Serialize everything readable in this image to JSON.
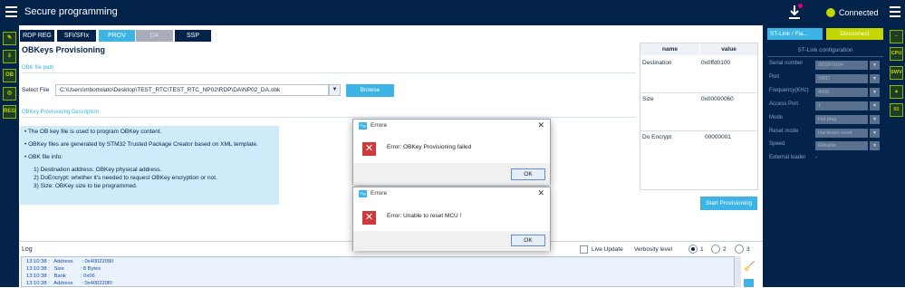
{
  "topbar": {
    "title": "Secure programming",
    "connection_status": "Connected"
  },
  "left_sidebar": {
    "items": [
      "edit",
      "download",
      "OB",
      "CPU",
      "REG"
    ]
  },
  "tabs": [
    {
      "label": "RDP REG",
      "state": "normal"
    },
    {
      "label": "SFI/SFIx",
      "state": "normal"
    },
    {
      "label": "PROV",
      "state": "active"
    },
    {
      "label": "DA",
      "state": "disabled"
    },
    {
      "label": "SSP",
      "state": "normal"
    }
  ],
  "panel": {
    "title": "OBKeys Provisioning",
    "file_section_label": "OBK file path",
    "select_file_label": "Select File",
    "file_path": "C:\\Users\\mbortolato\\Desktop\\TEST_RTC\\TEST_RTC_NP02\\RDP\\DA\\NP02_DA.obk",
    "browse_label": "Browse",
    "desc_section_label": "OBKey Provisioning Description",
    "description": {
      "line1": "• The OB key file is used to program OBKey content.",
      "line2": "• OBKey files are generated by STM32 Trusted Package Creator based on XML template.",
      "line3": "• OBK file info:",
      "item1": "1)  Destination address: OBKey physical address.",
      "item2": "2)  DoEncrypt: whether it's needed to request OBKey encryption or not.",
      "item3": "3)  Size: OBKey size to be programmed."
    }
  },
  "table": {
    "headers": [
      "name",
      "value"
    ],
    "rows": [
      {
        "name": "Destination",
        "value": "0x0ffd0100"
      },
      {
        "name": "Size",
        "value": "0x00000060"
      },
      {
        "name": "Do Encrypt",
        "value": "00000001"
      }
    ]
  },
  "start_button_label": "Start Provisioning",
  "log": {
    "label": "Log",
    "live_update_label": "Live Update",
    "verbosity_label": "Verbosity level",
    "verbosity_options": [
      "1",
      "2",
      "3"
    ],
    "verbosity_selected": "1",
    "lines": [
      "13:10:38 :   Address      : 0x40022090",
      "13:10:38 :   Size           : 8 Bytes",
      "13:10:38 :   Bank          : 0x06",
      "13:10:38 :   Address      : 0x400220f0"
    ]
  },
  "right_panel": {
    "probe_label": "ST-Link / Fla...",
    "disconnect_label": "Disconnect",
    "config_title": "ST-Link configuration",
    "fields": [
      {
        "label": "Serial number",
        "value": "0032F9164"
      },
      {
        "label": "Port",
        "value": "SWD"
      },
      {
        "label": "Frequency(KHz)",
        "value": "4000"
      },
      {
        "label": "Access Port",
        "value": "1"
      },
      {
        "label": "Mode",
        "value": "Hot plug"
      },
      {
        "label": "Reset mode",
        "value": "Hardware reset"
      },
      {
        "label": "Speed",
        "value": "Reliable"
      },
      {
        "label": "External loader",
        "value": "-"
      }
    ]
  },
  "far_right_bar": {
    "items": [
      "CPU",
      "SWV",
      "EL",
      "OTP"
    ]
  },
  "dialog1": {
    "title": "Errore",
    "message": "Error: OBKey Provisioning failed",
    "ok_label": "OK"
  },
  "dialog2": {
    "title": "Errore",
    "message": "Error: Unable to reset MCU !",
    "ok_label": "OK"
  }
}
